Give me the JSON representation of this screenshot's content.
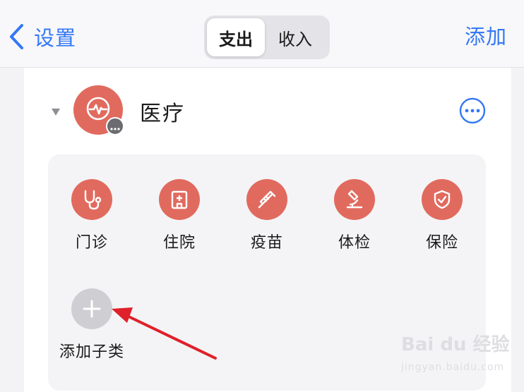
{
  "nav": {
    "back_label": "设置",
    "segments": [
      "支出",
      "收入"
    ],
    "active_segment": "支出",
    "add_label": "添加"
  },
  "category": {
    "title": "医疗",
    "icon": "heartbeat-icon",
    "badge_icon": "ellipsis-icon",
    "more_icon": "ellipsis-circle-icon",
    "color": "#e16a5e"
  },
  "subcategories": [
    {
      "label": "门诊",
      "icon": "stethoscope-icon"
    },
    {
      "label": "住院",
      "icon": "hospital-bed-icon"
    },
    {
      "label": "疫苗",
      "icon": "syringe-icon"
    },
    {
      "label": "体检",
      "icon": "microscope-icon"
    },
    {
      "label": "保险",
      "icon": "shield-check-icon"
    }
  ],
  "add_subcategory": {
    "label": "添加子类",
    "icon": "plus-icon"
  },
  "colors": {
    "accent": "#3478f6",
    "category": "#e16a5e",
    "arrow": "#e0202a"
  },
  "watermark": {
    "brand": "Bai du 经验",
    "url": "jingyan.baidu.com"
  }
}
